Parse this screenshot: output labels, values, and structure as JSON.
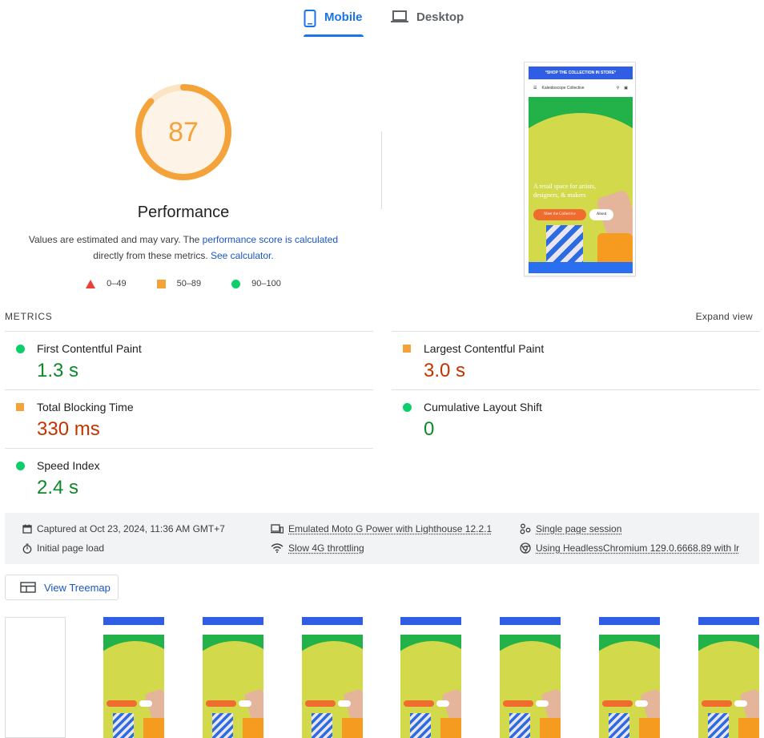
{
  "tabs": {
    "mobile": "Mobile",
    "desktop": "Desktop"
  },
  "score": {
    "value": "87",
    "fraction": 0.87,
    "category": "Performance",
    "desc_prefix": "Values are estimated and may vary. The ",
    "desc_link1": "performance score is calculated",
    "desc_mid": " directly from these metrics. ",
    "desc_link2": "See calculator.",
    "color": "#f4a23a"
  },
  "legend": {
    "fail": "0–49",
    "average": "50–89",
    "pass": "90–100"
  },
  "preview": {
    "banner": "*SHOP THE COLLECTION IN STORE*",
    "brand": "Kaleidoscope Collective",
    "headline": "A retail space for artists, designers, & makers",
    "button_primary": "Meet the Collective",
    "button_secondary": "About"
  },
  "metrics": {
    "heading": "METRICS",
    "expand": "Expand view",
    "fcp": {
      "label": "First Contentful Paint",
      "value": "1.3 s",
      "status": "pass"
    },
    "lcp": {
      "label": "Largest Contentful Paint",
      "value": "3.0 s",
      "status": "average"
    },
    "tbt": {
      "label": "Total Blocking Time",
      "value": "330 ms",
      "status": "average"
    },
    "cls": {
      "label": "Cumulative Layout Shift",
      "value": "0",
      "status": "pass"
    },
    "si": {
      "label": "Speed Index",
      "value": "2.4 s",
      "status": "pass"
    }
  },
  "info": {
    "captured": "Captured at Oct 23, 2024, 11:36 AM GMT+7",
    "initial": "Initial page load",
    "emulated": "Emulated Moto G Power with Lighthouse 12.2.1",
    "throttling": "Slow 4G throttling",
    "session": "Single page session",
    "browser": "Using HeadlessChromium 129.0.6668.89 with lr"
  },
  "treemap": {
    "label": "View Treemap"
  },
  "colors": {
    "accent": "#1a73e8",
    "pass": "#0cce6b",
    "average": "#f4a23a",
    "fail": "#e8403a"
  }
}
